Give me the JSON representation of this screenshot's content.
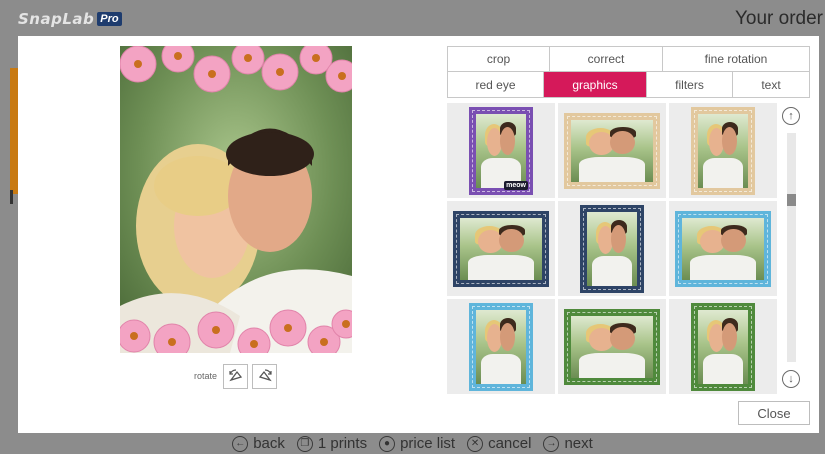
{
  "app": {
    "logo_text": "SnapLab",
    "logo_badge": "Pro",
    "title": "Your order"
  },
  "editor": {
    "rotate_label": "rotate",
    "tabs_row1": [
      {
        "label": "crop",
        "active": false
      },
      {
        "label": "correct",
        "active": false
      },
      {
        "label": "fine rotation",
        "active": false
      }
    ],
    "tabs_row2": [
      {
        "label": "red eye",
        "active": false
      },
      {
        "label": "graphics",
        "active": true
      },
      {
        "label": "filters",
        "active": false
      },
      {
        "label": "text",
        "active": false
      }
    ],
    "graphics": [
      {
        "style": "purple-cat-frame",
        "shape": "portrait",
        "color": "#7a4fb2",
        "caption": "meow"
      },
      {
        "style": "beige-ornament-frame",
        "shape": "landscape",
        "color": "#e2c89e"
      },
      {
        "style": "beige-ornament-frame",
        "shape": "portrait",
        "color": "#e2c89e"
      },
      {
        "style": "navy-lace-frame",
        "shape": "landscape",
        "color": "#2e4466"
      },
      {
        "style": "navy-lace-frame",
        "shape": "portrait",
        "color": "#2e4466"
      },
      {
        "style": "sky-blue-frame",
        "shape": "landscape",
        "color": "#5fb5db"
      },
      {
        "style": "sky-blue-frame",
        "shape": "portrait",
        "color": "#5fb5db"
      },
      {
        "style": "green-floral-frame",
        "shape": "landscape",
        "color": "#4f8a3c"
      },
      {
        "style": "green-floral-frame",
        "shape": "portrait",
        "color": "#4f8a3c"
      }
    ],
    "scrollbar": {
      "position_fraction": 0.28
    },
    "close_label": "Close"
  },
  "nav": {
    "back": "back",
    "prints": "1 prints",
    "price_list": "price list",
    "cancel": "cancel",
    "next": "next"
  },
  "colors": {
    "accent": "#d5195a",
    "backdrop": "#8c8c8c"
  }
}
